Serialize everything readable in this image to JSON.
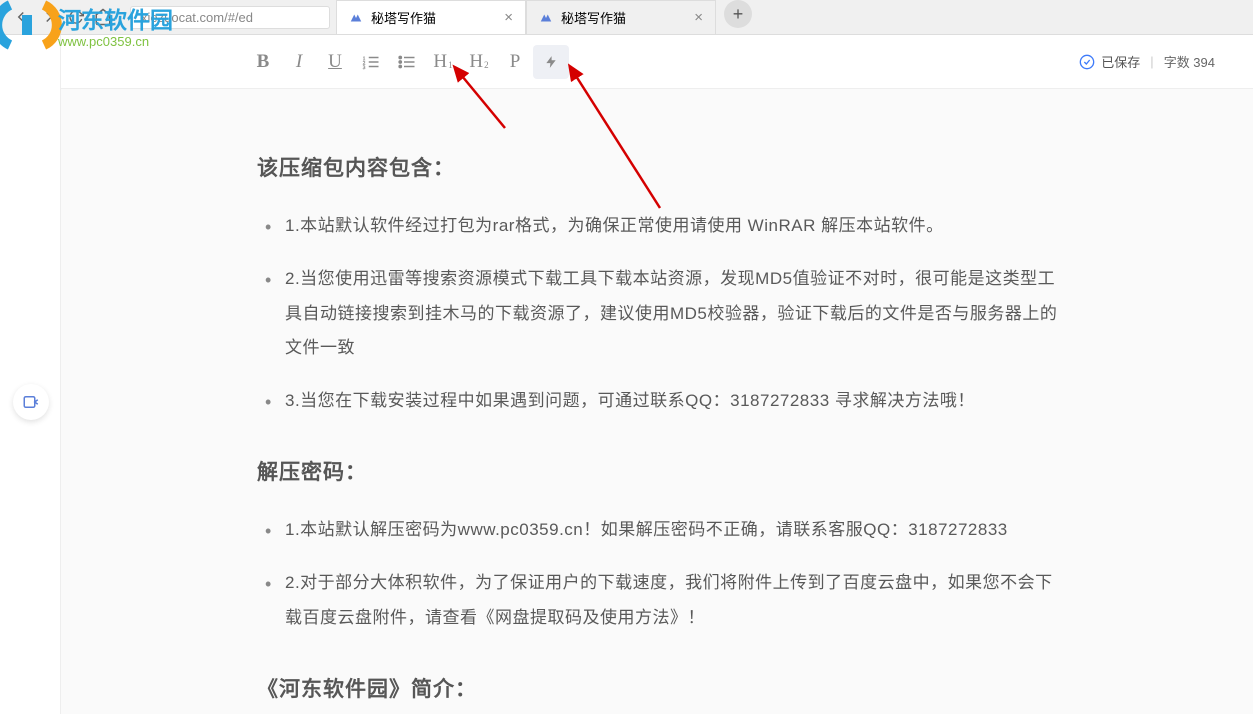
{
  "browser": {
    "url": "xiezuocat.com/#/ed",
    "tabs": [
      {
        "title": "秘塔写作猫",
        "active": true
      },
      {
        "title": "秘塔写作猫",
        "active": false
      }
    ]
  },
  "watermark": {
    "title": "河东软件园",
    "url": "www.pc0359.cn"
  },
  "toolbar": {
    "bold": "B",
    "italic": "I",
    "underline": "U",
    "ol": "ol",
    "ul": "ul",
    "h1": "H",
    "h1_sub": "1",
    "h2": "H",
    "h2_sub": "2",
    "p": "P",
    "flash": "⚡"
  },
  "status": {
    "saved_label": "已保存",
    "word_count_label": "字数 394"
  },
  "document": {
    "heading1": "该压缩包内容包含：",
    "list1": [
      "1.本站默认软件经过打包为rar格式，为确保正常使用请使用 WinRAR 解压本站软件。",
      "2.当您使用迅雷等搜索资源模式下载工具下载本站资源，发现MD5值验证不对时，很可能是这类型工具自动链接搜索到挂木马的下载资源了，建议使用MD5校验器，验证下载后的文件是否与服务器上的文件一致",
      "3.当您在下载安装过程中如果遇到问题，可通过联系QQ：3187272833 寻求解决方法哦！"
    ],
    "heading2": "解压密码：",
    "list2": [
      "1.本站默认解压密码为www.pc0359.cn！如果解压密码不正确，请联系客服QQ：3187272833",
      "2.对于部分大体积软件，为了保证用户的下载速度，我们将附件上传到了百度云盘中，如果您不会下载百度云盘附件，请查看《网盘提取码及使用方法》！"
    ],
    "heading3": "《河东软件园》简介："
  }
}
